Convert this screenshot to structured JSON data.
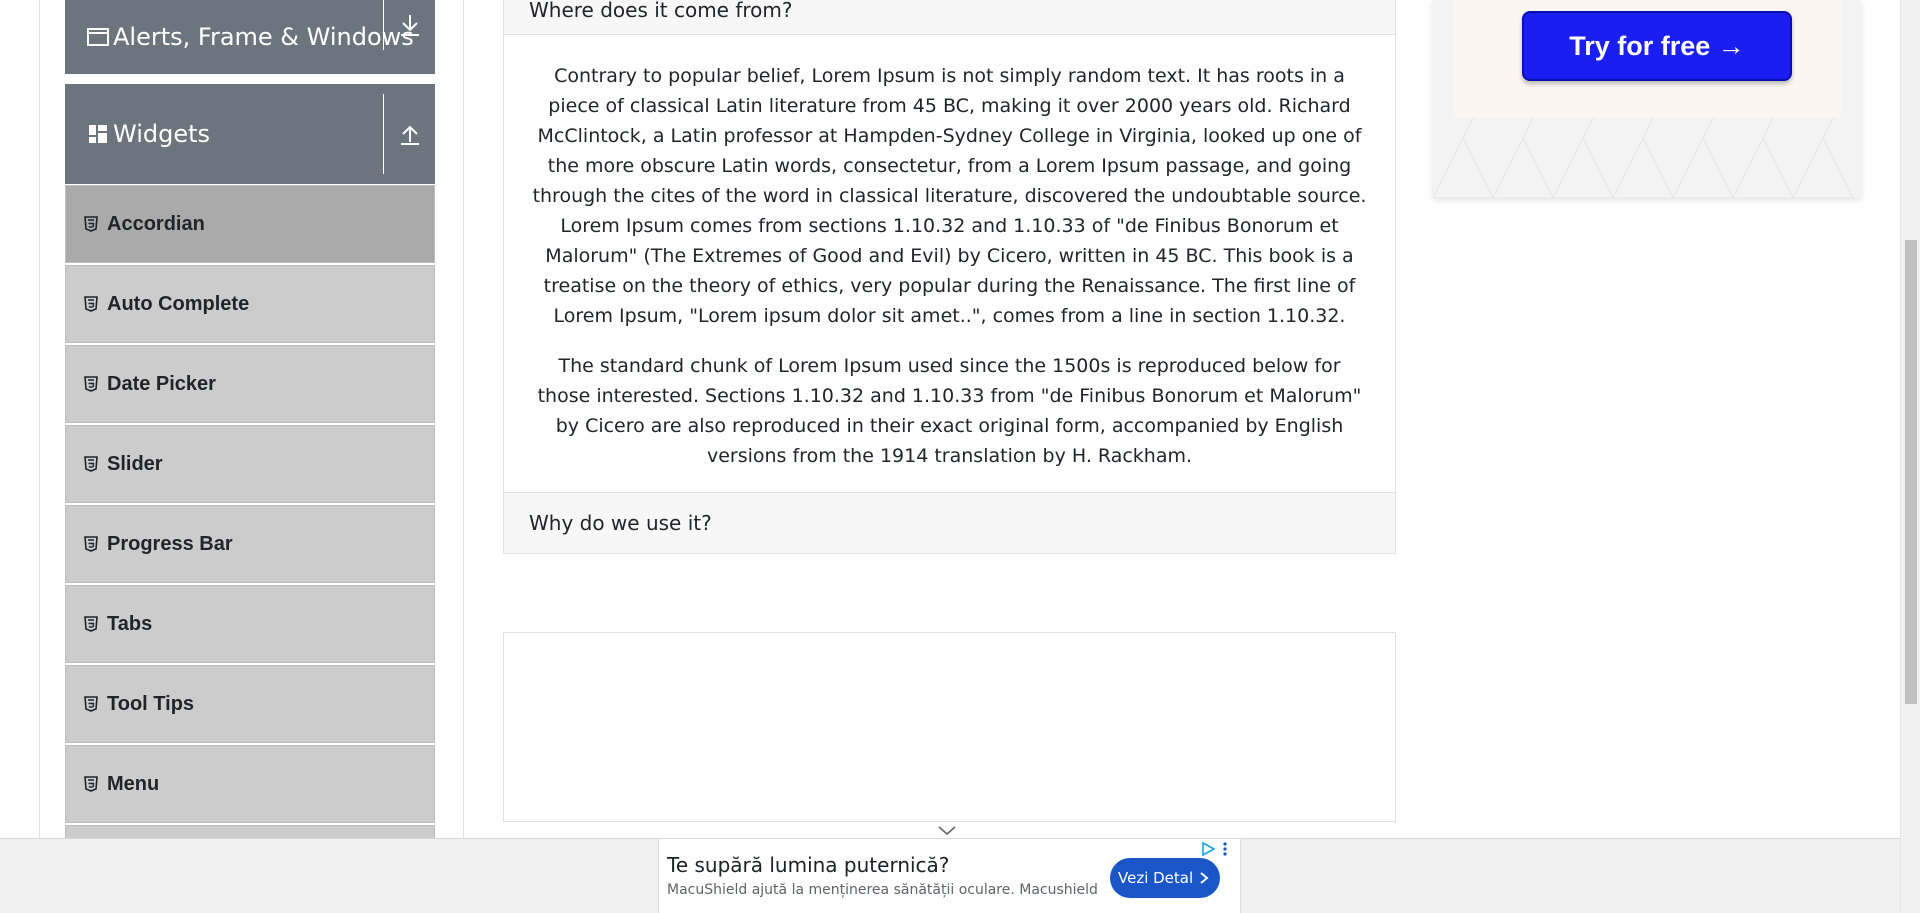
{
  "sidebar": {
    "alerts_group": {
      "label": "Alerts, Frame & Windows"
    },
    "widgets_group": {
      "label": "Widgets"
    },
    "items": [
      {
        "label": "Accordian",
        "active": true
      },
      {
        "label": "Auto Complete",
        "active": false
      },
      {
        "label": "Date Picker",
        "active": false
      },
      {
        "label": "Slider",
        "active": false
      },
      {
        "label": "Progress Bar",
        "active": false
      },
      {
        "label": "Tabs",
        "active": false
      },
      {
        "label": "Tool Tips",
        "active": false
      },
      {
        "label": "Menu",
        "active": false
      }
    ]
  },
  "accordion": {
    "section_where": {
      "title": "Where does it come from?",
      "paragraphs": [
        "Contrary to popular belief, Lorem Ipsum is not simply random text. It has roots in a piece of classical Latin literature from 45 BC, making it over 2000 years old. Richard McClintock, a Latin professor at Hampden-Sydney College in Virginia, looked up one of the more obscure Latin words, consectetur, from a Lorem Ipsum passage, and going through the cites of the word in classical literature, discovered the undoubtable source. Lorem Ipsum comes from sections 1.10.32 and 1.10.33 of \"de Finibus Bonorum et Malorum\" (The Extremes of Good and Evil) by Cicero, written in 45 BC. This book is a treatise on the theory of ethics, very popular during the Renaissance. The first line of Lorem Ipsum, \"Lorem ipsum dolor sit amet..\", comes from a line in section 1.10.32.",
        "The standard chunk of Lorem Ipsum used since the 1500s is reproduced below for those interested. Sections 1.10.32 and 1.10.33 from \"de Finibus Bonorum et Malorum\" by Cicero are also reproduced in their exact original form, accompanied by English versions from the 1914 translation by H. Rackham."
      ]
    },
    "section_why": {
      "title": "Why do we use it?"
    }
  },
  "right_ad": {
    "button_label": "Try for free →",
    "button_color": "#1a1ef0"
  },
  "bottom_ad": {
    "title": "Te supără lumina puternică?",
    "description": "MacuShield ajută la menținerea sănătății oculare. Macushield",
    "cta_label": "Vezi Detalii"
  },
  "colors": {
    "sidebar_group_bg": "#6c757d",
    "sidebar_item_bg": "#cccccc",
    "sidebar_item_active_bg": "#aaaaaa",
    "accordion_header_bg": "#f7f7f7"
  },
  "icons": {
    "alerts_group": "window-icon",
    "widgets_group": "widgets-icon",
    "alerts_toggle": "download-arrow-icon",
    "widgets_toggle": "upload-arrow-icon",
    "menu_item": "html5-icon"
  }
}
